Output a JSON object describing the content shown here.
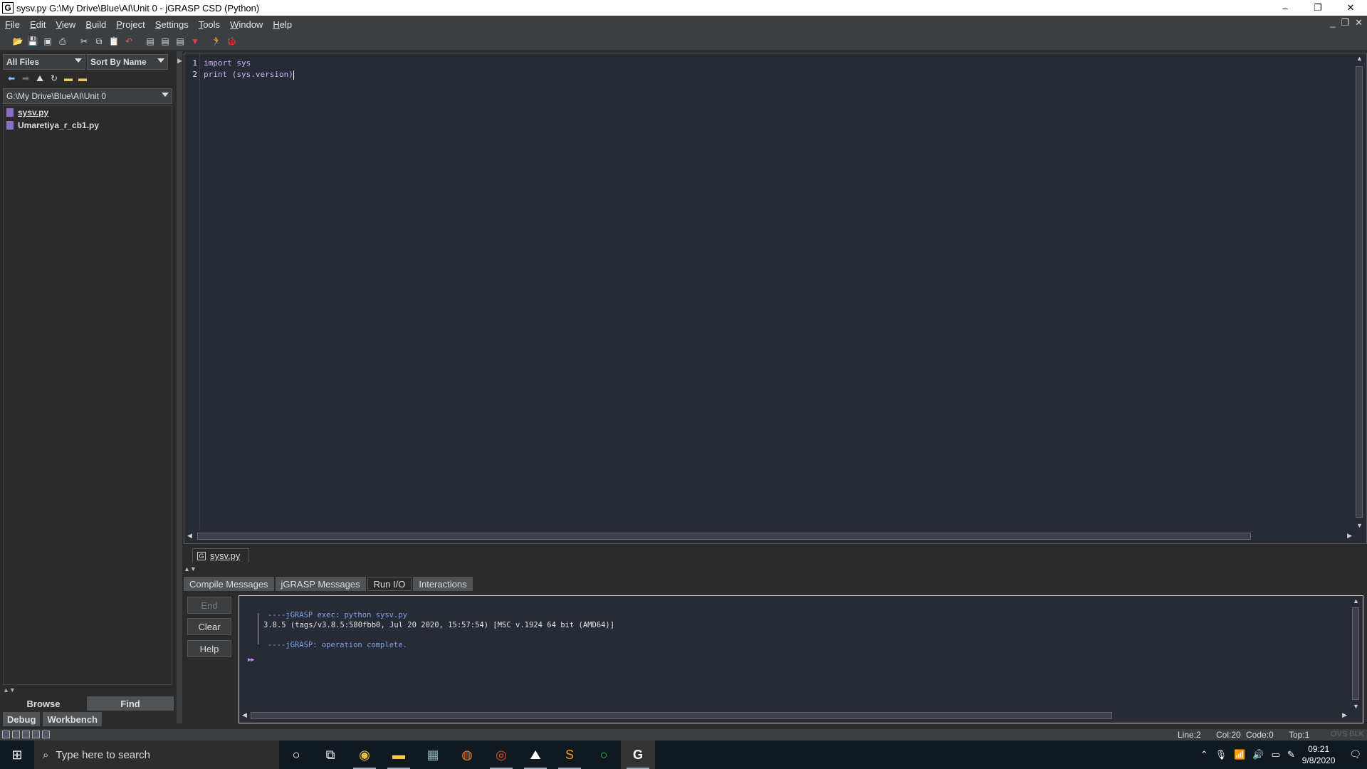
{
  "window": {
    "title": "sysv.py  G:\\My Drive\\Blue\\AI\\Unit 0 - jGRASP CSD (Python)",
    "app_icon": "G",
    "controls": [
      "–",
      "❐",
      "✕"
    ]
  },
  "menu": [
    "File",
    "Edit",
    "View",
    "Build",
    "Project",
    "Settings",
    "Tools",
    "Window",
    "Help"
  ],
  "mdi_controls": [
    "_",
    "❐",
    "✕"
  ],
  "toolbar": {
    "icons": [
      "open-icon",
      "save-icon",
      "save-all-icon",
      "print-icon",
      "cut-icon",
      "copy-icon",
      "paste-icon",
      "undo-icon",
      "document-icon",
      "document-icon",
      "document-icon",
      "bookmark-icon",
      "run-icon",
      "debug-icon"
    ]
  },
  "browse": {
    "filter": "All Files",
    "sort": "Sort By Name",
    "path": "G:\\My Drive\\Blue\\AI\\Unit 0",
    "files": [
      {
        "name": "sysv.py",
        "selected": true
      },
      {
        "name": "Umaretiya_r_cb1.py",
        "selected": false
      }
    ],
    "tabs": {
      "browse": "Browse",
      "find": "Find",
      "debug": "Debug",
      "workbench": "Workbench"
    }
  },
  "editor": {
    "line_numbers": [
      "1",
      "2"
    ],
    "lines": [
      "import sys",
      "print (sys.version)"
    ],
    "tab_label": "sysv.py",
    "colors": {
      "background": "#262b36",
      "code": "#c9b5f3"
    }
  },
  "messages": {
    "tabs": [
      "Compile Messages",
      "jGRASP Messages",
      "Run I/O",
      "Interactions"
    ],
    "active_tab": "Run I/O",
    "buttons": {
      "end": "End",
      "clear": "Clear",
      "help": "Help"
    },
    "output": {
      "exec_line": "----jGRASP exec: python sysv.py",
      "version_line": "3.8.5 (tags/v3.8.5:580fbb0, Jul 20 2020, 15:57:54) [MSC v.1924 64 bit (AMD64)]",
      "complete_line": "----jGRASP: operation complete.",
      "prompt": "▸▸"
    }
  },
  "status": {
    "line": "Line:2",
    "col": "Col:20",
    "code": "Code:0",
    "top": "Top:1",
    "mode": "OVS BLK"
  },
  "taskbar": {
    "search_placeholder": "Type here to search",
    "time": "09:21",
    "date": "9/8/2020"
  }
}
